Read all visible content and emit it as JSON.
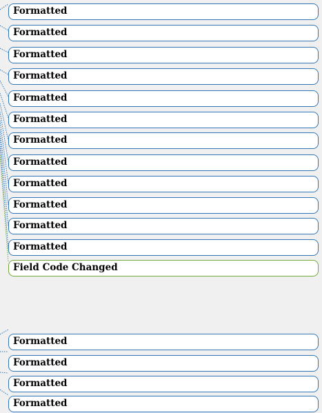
{
  "colors": {
    "background": "#f0f0f0",
    "format_balloon_border": "#2e75b6",
    "field_change_balloon_border": "#70a83b",
    "balloon_fill": "#ffffff",
    "text": "#000000"
  },
  "balloons": [
    {
      "kind": "format",
      "label": "Formatted"
    },
    {
      "kind": "format",
      "label": "Formatted"
    },
    {
      "kind": "format",
      "label": "Formatted"
    },
    {
      "kind": "format",
      "label": "Formatted"
    },
    {
      "kind": "format",
      "label": "Formatted"
    },
    {
      "kind": "format",
      "label": "Formatted"
    },
    {
      "kind": "format",
      "label": "Formatted"
    },
    {
      "kind": "format",
      "label": "Formatted"
    },
    {
      "kind": "format",
      "label": "Formatted"
    },
    {
      "kind": "format",
      "label": "Formatted"
    },
    {
      "kind": "format",
      "label": "Formatted"
    },
    {
      "kind": "format",
      "label": "Formatted"
    },
    {
      "kind": "field_change",
      "label": "Field Code Changed"
    },
    {
      "kind": "format",
      "label": "Formatted"
    },
    {
      "kind": "format",
      "label": "Formatted"
    },
    {
      "kind": "format",
      "label": "Formatted"
    },
    {
      "kind": "format",
      "label": "Formatted"
    }
  ]
}
